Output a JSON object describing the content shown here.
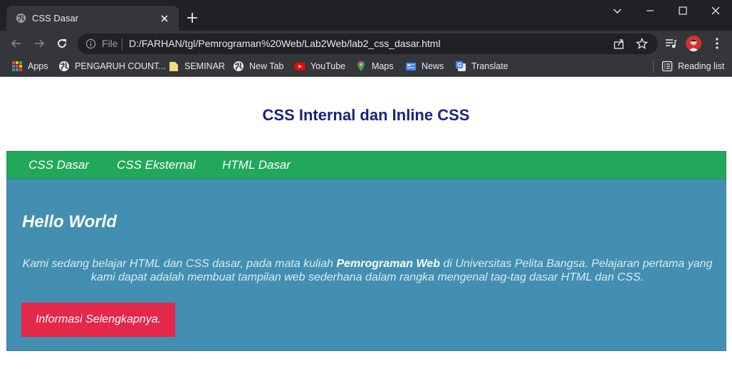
{
  "browser": {
    "tab_title": "CSS Dasar",
    "omnibox": {
      "scheme_label": "File",
      "url": "D:/FARHAN/tgl/Pemrograman%20Web/Lab2Web/lab2_css_dasar.html"
    },
    "bookmarks": [
      {
        "label": "Apps",
        "icon": "apps-grid-icon"
      },
      {
        "label": "PENGARUH COUNT...",
        "icon": "globe-icon"
      },
      {
        "label": "SEMINAR",
        "icon": "folder-icon"
      },
      {
        "label": "New Tab",
        "icon": "globe-icon"
      },
      {
        "label": "YouTube",
        "icon": "youtube-icon"
      },
      {
        "label": "Maps",
        "icon": "maps-pin-icon"
      },
      {
        "label": "News",
        "icon": "news-icon"
      },
      {
        "label": "Translate",
        "icon": "translate-icon"
      }
    ],
    "reading_list_label": "Reading list"
  },
  "page": {
    "title": "CSS Internal dan Inline CSS",
    "nav": [
      "CSS Dasar",
      "CSS Eksternal",
      "HTML Dasar"
    ],
    "heading": "Hello World",
    "desc_before": "Kami sedang belajar HTML dan CSS dasar, pada mata kuliah ",
    "desc_bold": "Pemrograman Web",
    "desc_after": " di Universitas Pelita Bangsa. Pelajaran pertama yang kami dapat adalah membuat tampilan web sederhana dalam rangka mengenal tag-tag dasar HTML dan CSS.",
    "button_label": "Informasi Selengkapnya."
  },
  "colors": {
    "page_title": "#1a237e",
    "nav_bg": "#22a85a",
    "content_bg": "#428fb2",
    "button_bg": "#e3284a"
  }
}
